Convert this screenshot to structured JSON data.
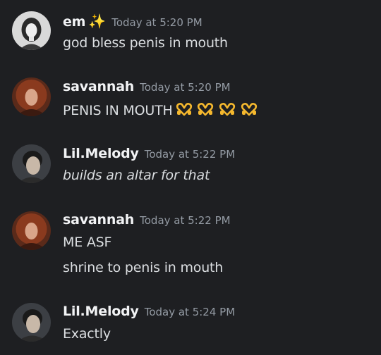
{
  "messages": [
    {
      "username": "em",
      "badge_icon": "sparkles-icon",
      "timestamp": "Today at 5:20 PM",
      "lines": [
        "god bless penis in mouth"
      ]
    },
    {
      "username": "savannah",
      "timestamp": "Today at 5:20 PM",
      "lines": [
        "PENIS IN MOUTH"
      ],
      "emoji": "heart-hands-icon",
      "emoji_count": 4
    },
    {
      "username": "Lil.Melody",
      "timestamp": "Today at 5:22 PM",
      "lines": [
        "builds an altar for that"
      ]
    },
    {
      "username": "savannah",
      "timestamp": "Today at 5:22 PM",
      "lines": [
        "ME ASF",
        "shrine to penis in mouth"
      ]
    },
    {
      "username": "Lil.Melody",
      "timestamp": "Today at 5:24 PM",
      "lines": [
        "Exactly"
      ]
    }
  ],
  "colors": {
    "background": "#1e1f22",
    "username": "#f2f3f5",
    "timestamp": "#949ba4",
    "text": "#dbdee1",
    "emoji": "#f5b82e"
  }
}
